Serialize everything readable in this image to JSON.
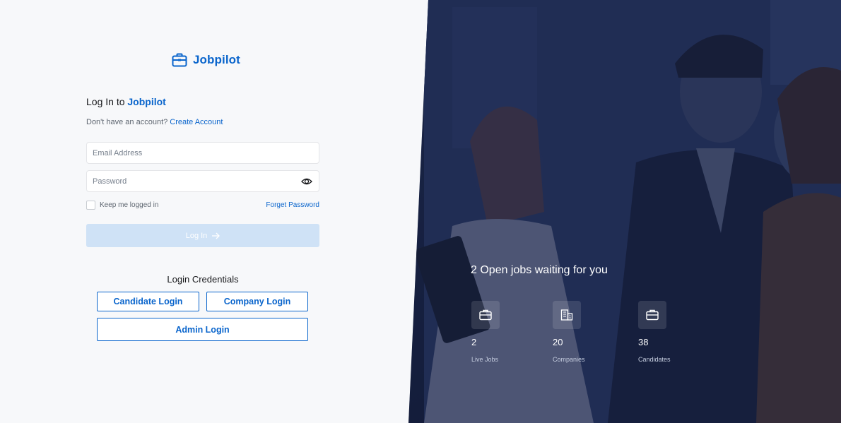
{
  "brand": {
    "name": "Jobpilot",
    "logo_icon": "briefcase-icon",
    "accent": "#0a65cc"
  },
  "login": {
    "title_prefix": "Log In to",
    "title_brand": "Jobpilot",
    "signup_prompt": "Don't have an account?",
    "signup_link": "Create Account",
    "email_placeholder": "Email Address",
    "password_placeholder": "Password",
    "remember_label": "Keep me logged in",
    "forgot_link": "Forget Password",
    "submit_label": "Log In"
  },
  "credentials": {
    "title": "Login Credentials",
    "candidate": "Candidate Login",
    "company": "Company Login",
    "admin": "Admin Login"
  },
  "hero": {
    "headline": "2 Open jobs waiting for you",
    "stats": [
      {
        "icon": "briefcase-icon",
        "value": "2",
        "label": "Live Jobs"
      },
      {
        "icon": "buildings-icon",
        "value": "20",
        "label": "Companies"
      },
      {
        "icon": "briefcase-icon",
        "value": "38",
        "label": "Candidates"
      }
    ]
  }
}
